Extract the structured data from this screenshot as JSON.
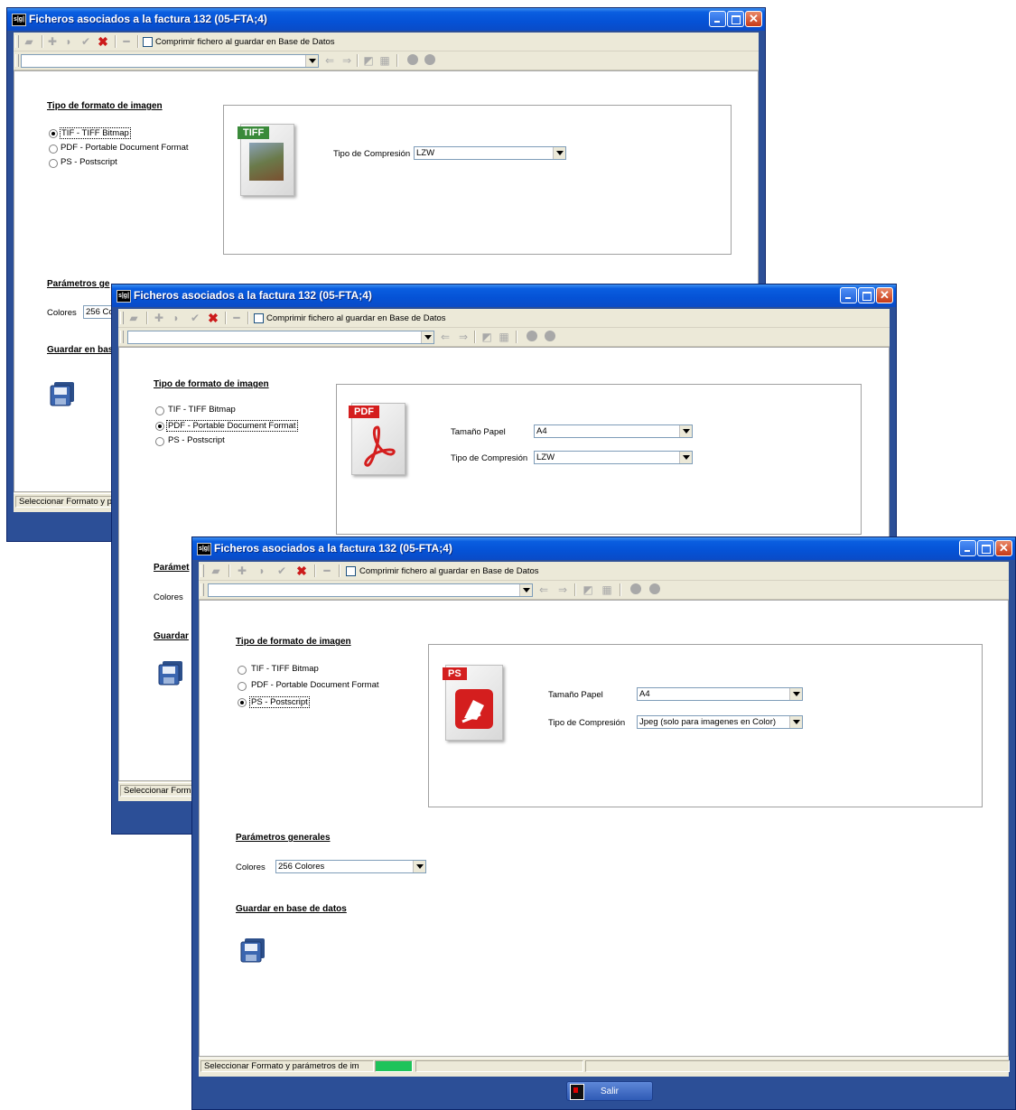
{
  "window_title": "Ficheros asociados a la factura 132 (05-FTA;4)",
  "app_icon_text": "s|g|",
  "toolbar": {
    "compress_label": "Comprimir fichero al guardar en Base de Datos"
  },
  "format_section_title": "Tipo de formato de imagen",
  "formats": [
    "TIF - TIFF Bitmap",
    "PDF - Portable Document Format",
    "PS - Postscript"
  ],
  "labels": {
    "paper_size": "Tamaño Papel",
    "compression": "Tipo de Compresión",
    "colors": "Colores"
  },
  "general_section_title": "Parámetros generales",
  "db_section_title": "Guardar en base de datos",
  "windows": {
    "tif": {
      "selected_format": "TIF - TIFF Bitmap",
      "compression": "LZW",
      "colors": "256 Co",
      "doc_tag": "TIFF",
      "cut_general": "Parámetros ge",
      "cut_db": "Guardar en bas",
      "status": "Seleccionar Formato y pa"
    },
    "pdf": {
      "selected_format": "PDF - Portable Document Format",
      "paper_size": "A4",
      "compression": "LZW",
      "doc_tag": "PDF",
      "cut_general": "Parámet",
      "cut_db": "Guardar",
      "status": "Seleccionar Form"
    },
    "ps": {
      "selected_format": "PS - Postscript",
      "paper_size": "A4",
      "compression": "Jpeg (solo para imagenes en Color)",
      "colors": "256 Colores",
      "doc_tag": "PS",
      "status": "Seleccionar Formato y parámetros de im",
      "exit_label": "Salir"
    }
  },
  "colors": {
    "titlebar": "#0552d6",
    "frame": "#2c4f97",
    "progress": "#1ec35a"
  }
}
